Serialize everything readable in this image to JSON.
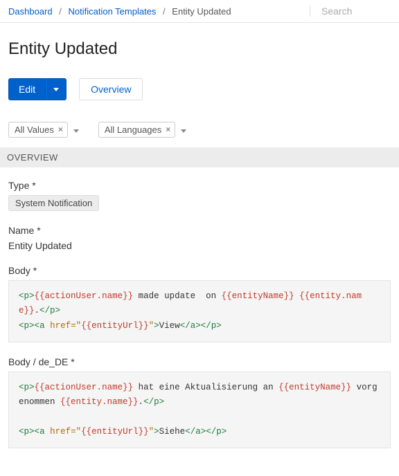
{
  "breadcrumb": {
    "dashboard": "Dashboard",
    "templates": "Notification Templates",
    "current": "Entity Updated"
  },
  "search": {
    "placeholder": "Search"
  },
  "page": {
    "title": "Entity Updated"
  },
  "actions": {
    "edit": "Edit",
    "overview": "Overview"
  },
  "filters": {
    "values": "All Values",
    "languages": "All Languages"
  },
  "section": {
    "overview": "OVERVIEW"
  },
  "fields": {
    "type_label": "Type *",
    "type_value": "System Notification",
    "name_label": "Name *",
    "name_value": "Entity Updated",
    "body_label": "Body *",
    "body_de_label": "Body / de_DE *"
  },
  "body_code": {
    "t1": "<",
    "p1": "p",
    "t2": ">",
    "v1": "{{actionUser.name}}",
    "txt1": " made update  on ",
    "v2": "{{entityName}}",
    "sp1": " ",
    "v3": "{{entity.name}}",
    "dot1": ".",
    "t3": "</",
    "p2": "p",
    "t4": ">",
    "nl1": "\n",
    "t5": "<",
    "p3": "p",
    "t6": ">",
    "t7": "<",
    "a1": "a",
    "sp2": " ",
    "attr1": "href=\"",
    "v4": "{{entityUrl}}",
    "attr2": "\"",
    "t8": ">",
    "txt2": "View",
    "t9": "</",
    "a2": "a",
    "t10": ">",
    "t11": "</",
    "p4": "p",
    "t12": ">"
  },
  "body_de_code": {
    "t1": "<",
    "p1": "p",
    "t2": ">",
    "v1": "{{actionUser.name}}",
    "txt1": " hat eine Aktualisierung an ",
    "v2": "{{entityName}}",
    "txt2": " vorgenommen ",
    "v3": "{{entity.name}}",
    "dot1": ".",
    "t3": "</",
    "p2": "p",
    "t4": ">",
    "nl1": "\n\n",
    "t5": "<",
    "p3": "p",
    "t6": ">",
    "t7": "<",
    "a1": "a",
    "sp2": " ",
    "attr1": "href=\"",
    "v4": "{{entityUrl}}",
    "attr2": "\"",
    "t8": ">",
    "txt3": "Siehe",
    "t9": "</",
    "a2": "a",
    "t10": ">",
    "t11": "</",
    "p4": "p",
    "t12": ">"
  }
}
